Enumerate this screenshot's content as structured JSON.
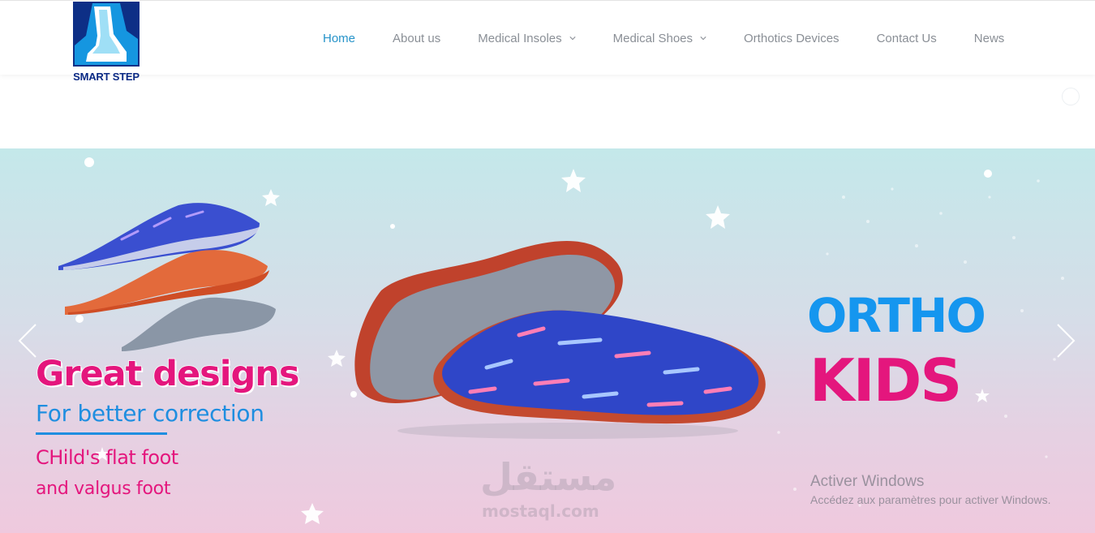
{
  "brand": {
    "name": "SMART STEP",
    "logo_bg": "#1596e0",
    "logo_border": "#0d2f86"
  },
  "nav": {
    "items": [
      {
        "label": "Home",
        "active": true
      },
      {
        "label": "About us"
      },
      {
        "label": "Medical Insoles",
        "dropdown": true
      },
      {
        "label": "Medical Shoes",
        "dropdown": true
      },
      {
        "label": "Orthotics Devices"
      },
      {
        "label": "Contact Us"
      },
      {
        "label": "News"
      }
    ],
    "active_color": "#2693c9",
    "text_color": "#8a8f96"
  },
  "slide": {
    "headline": "Great designs",
    "subline": "For better correction",
    "child_line1": "CHild's flat foot",
    "child_line2": "and valgus foot",
    "ortho": "ORTHO",
    "kids": "KIDS",
    "accent_pink": "#e4167d",
    "accent_blue": "#1596ef",
    "prev_icon": "chevron-left-icon",
    "next_icon": "chevron-right-icon"
  },
  "watermark": {
    "arabic": "مستقل",
    "url": "mostaql.com"
  },
  "windows_notice": {
    "title": "Activer Windows",
    "subtitle": "Accédez aux paramètres pour activer Windows."
  }
}
